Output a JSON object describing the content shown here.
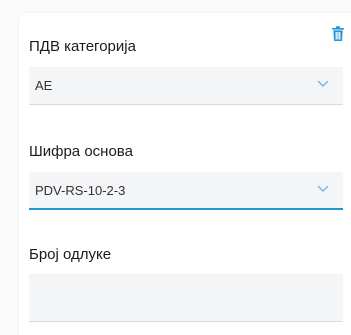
{
  "form": {
    "vat_category": {
      "label": "ПДВ категорија",
      "value": "AE"
    },
    "basis_code": {
      "label": "Шифра основа",
      "value": "PDV-RS-10-2-3"
    },
    "decision_number": {
      "label": "Број одлуке",
      "value": ""
    }
  },
  "icons": {
    "delete": "trash-icon",
    "dropdown": "chevron-down-icon"
  },
  "colors": {
    "accent": "#2a93d5",
    "field_bg": "#f4f5f7",
    "chevron": "#7fb6e0"
  }
}
